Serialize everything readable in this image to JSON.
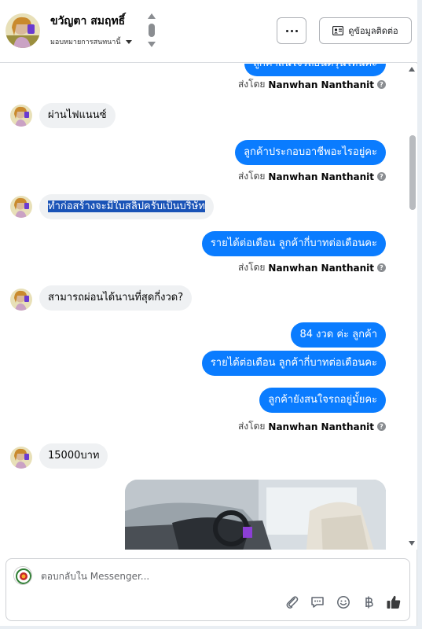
{
  "header": {
    "name": "ขวัญตา สมฤทธิ์",
    "assign_label": "มอบหมายการสนทนานี้",
    "contact_button": "ดูข้อมูลติดต่อ",
    "more_icon": "more-horizontal-icon",
    "contact_icon": "contact-card-icon"
  },
  "messages": [
    {
      "id": "m0",
      "side": "out",
      "text": "ลูกค้าสนใจรถยนต์รุ่นไหนคะ"
    },
    {
      "id": "m1",
      "side": "in",
      "text": "ผ่านไฟแนนซ์"
    },
    {
      "id": "m2",
      "side": "out",
      "text": "ลูกค้าประกอบอาชีพอะไรอยู่คะ"
    },
    {
      "id": "m3",
      "side": "in",
      "text": "ทำก่อสร้างจะมีใบสลิปครับเป็นบริษัท",
      "highlighted": true
    },
    {
      "id": "m4",
      "side": "out",
      "text": "รายได้ต่อเดือน ลูกค้ากี่บาทต่อเดือนคะ"
    },
    {
      "id": "m5",
      "side": "in",
      "text": "สามารถผ่อนได้นานที่สุดกี่งวด?"
    },
    {
      "id": "m6",
      "side": "out",
      "text": "84 งวด ค่ะ  ลูกค้า"
    },
    {
      "id": "m7",
      "side": "out",
      "text": "รายได้ต่อเดือน ลูกค้ากี่บาทต่อเดือนคะ"
    },
    {
      "id": "m8",
      "side": "out",
      "text": "ลูกค้ายังสนใจรถอยู่มั้ยคะ"
    },
    {
      "id": "m9",
      "side": "in",
      "text": "15000บาท"
    }
  ],
  "sent_by": {
    "prefix": "ส่งโดย",
    "name": "Nanwhan Nanthanit"
  },
  "composer": {
    "placeholder": "ตอบกลับใน Messenger...",
    "tools": [
      "paperclip-icon",
      "saved-reply-icon",
      "emoji-icon",
      "baht-icon",
      "thumbs-up-icon"
    ]
  },
  "colors": {
    "outgoing": "#0a7cff",
    "incoming": "#eff1f3",
    "highlight": "#1a53b7"
  }
}
